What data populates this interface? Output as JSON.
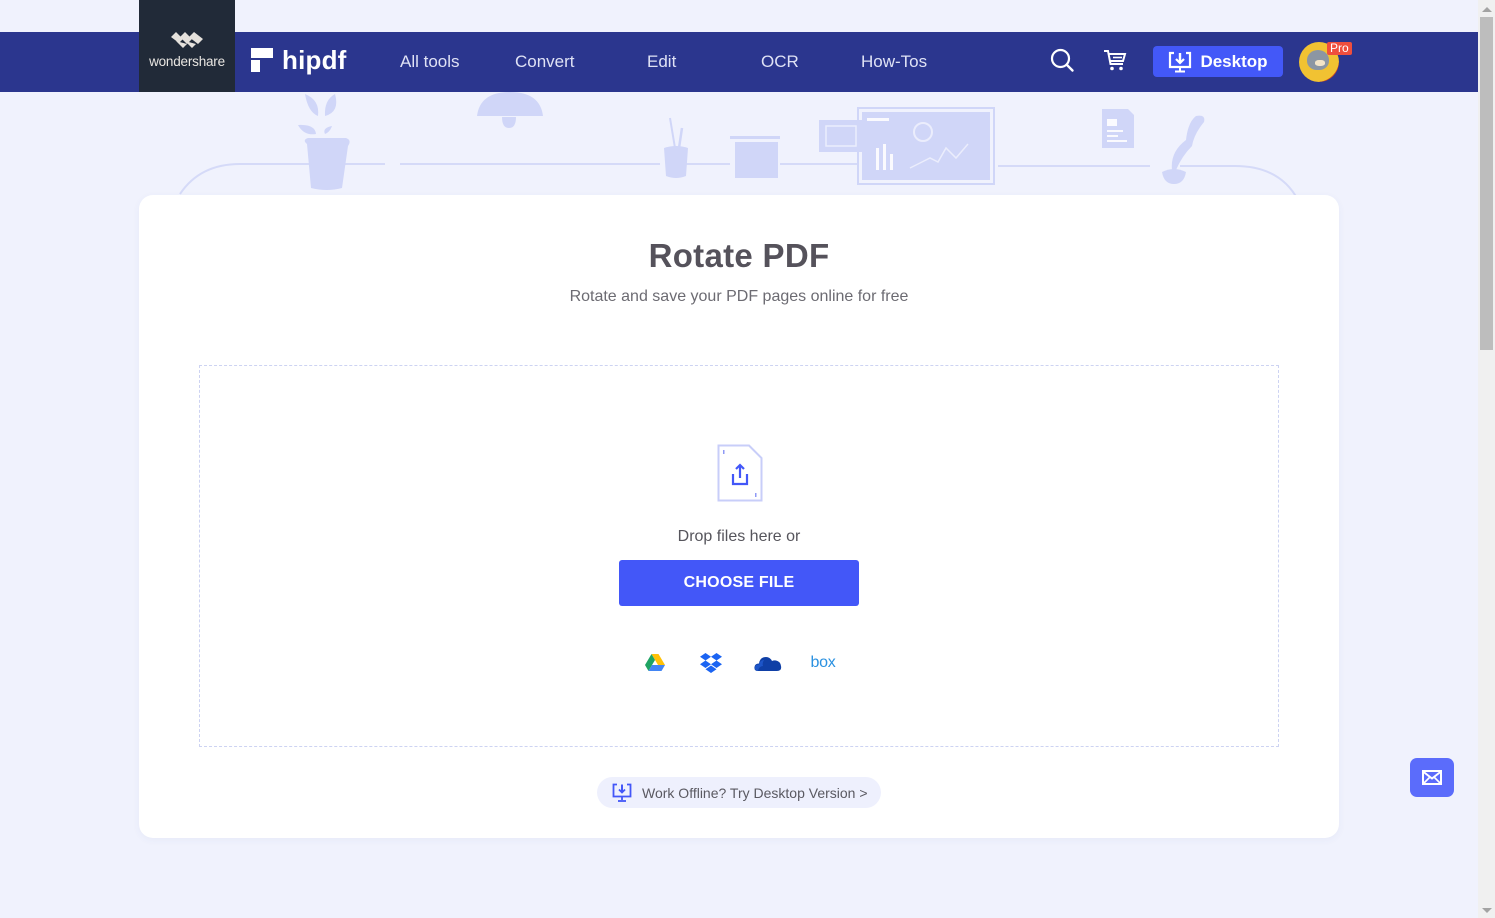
{
  "brand": {
    "parent_name": "wondershare",
    "product_name": "hipdf"
  },
  "nav": {
    "items": [
      {
        "label": "All tools"
      },
      {
        "label": "Convert"
      },
      {
        "label": "Edit"
      },
      {
        "label": "OCR"
      },
      {
        "label": "How-Tos"
      }
    ],
    "search_icon": "search-icon",
    "cart_icon": "cart-icon",
    "desktop_button_label": "Desktop",
    "avatar_badge": "Pro"
  },
  "page": {
    "title": "Rotate PDF",
    "subtitle": "Rotate and save your PDF pages online for free"
  },
  "upload": {
    "drop_text": "Drop files here or",
    "choose_button_label": "CHOOSE FILE",
    "cloud_sources": [
      {
        "name": "Google Drive",
        "icon": "google-drive-icon"
      },
      {
        "name": "Dropbox",
        "icon": "dropbox-icon"
      },
      {
        "name": "OneDrive",
        "icon": "onedrive-icon"
      },
      {
        "name": "Box",
        "icon": "box-icon",
        "label": "box"
      }
    ]
  },
  "offline_banner": {
    "label": "Work Offline? Try Desktop Version >"
  },
  "colors": {
    "nav_bg": "#2b368e",
    "brand_bg": "#212a38",
    "accent": "#4357f8",
    "page_bg": "#f0f2fd",
    "pro_badge": "#ef4e3d"
  }
}
